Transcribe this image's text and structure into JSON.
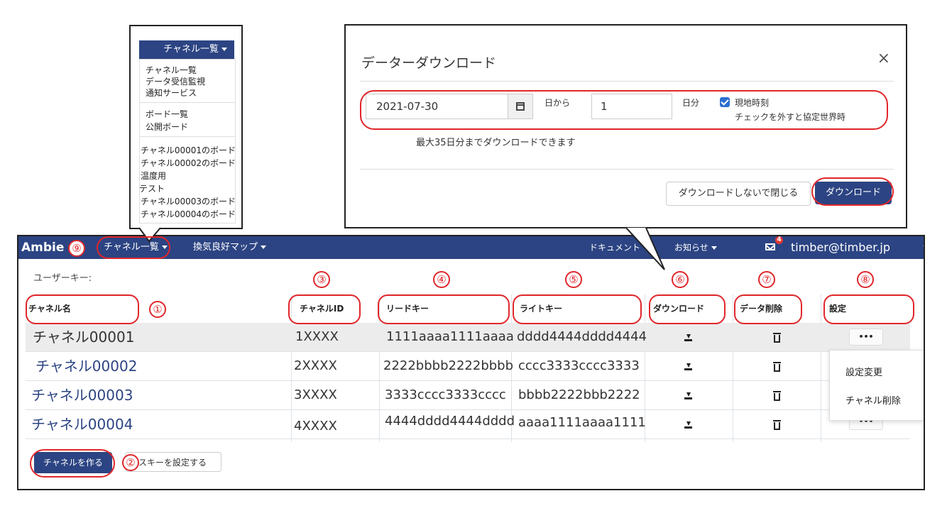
{
  "navbar": {
    "brand": "Ambie",
    "channel_menu": "チャネル一覧",
    "ventilation_map": "換気良好マップ",
    "documents": "ドキュメント",
    "notices": "お知らせ",
    "mail_badge": "4",
    "user": "timber@timber.jp"
  },
  "user_key_label": "ユーザーキー:",
  "table": {
    "headers": {
      "name": "チャネル名",
      "id": "チャネルID",
      "read_key": "リードキー",
      "write_key": "ライトキー",
      "download": "ダウンロード",
      "delete": "データ削除",
      "settings": "設定"
    },
    "rows": [
      {
        "name": "チャネル00001",
        "id": "1XXXX",
        "read_key": "1111aaaa1111aaaa",
        "write_key": "dddd4444dddd4444"
      },
      {
        "name": "チャネル00002",
        "id": "2XXXX",
        "read_key": "2222bbbb2222bbbb",
        "write_key": "cccc3333cccc3333"
      },
      {
        "name": "チャネル00003",
        "id": "3XXXX",
        "read_key": "3333cccc3333cccc",
        "write_key": "bbbb2222bbb2222"
      },
      {
        "name": "チャネル00004",
        "id": "4XXXX",
        "read_key": "4444dddd4444dddd",
        "write_key": "aaaa1111aaaa1111"
      }
    ],
    "settings_button": "•••"
  },
  "settings_menu": {
    "change": "設定変更",
    "delete": "チャネル削除"
  },
  "buttons": {
    "create_channel": "チャネルを作る",
    "set_key": "スキーを設定する"
  },
  "annotations": [
    "①",
    "②",
    "③",
    "④",
    "⑤",
    "⑥",
    "⑦",
    "⑧",
    "⑨"
  ],
  "channel_dropdown": {
    "title": "チャネル一覧",
    "group1": [
      "チャネル一覧",
      "データ受信監視",
      "通知サービス"
    ],
    "group2": [
      "ボード一覧",
      "公開ボード"
    ],
    "group3": [
      "チャネル00001のボード",
      "チャネル00002のボード",
      "温度用",
      "テスト",
      "チャネル00003のボード",
      "チャネル00004のボード"
    ]
  },
  "download_modal": {
    "title": "データーダウンロード",
    "close": "×",
    "date": "2021-07-30",
    "from_label": "日から",
    "days": "1",
    "days_label": "日分",
    "local_time_label": "現地時刻",
    "utc_note": "チェックを外すと協定世界時",
    "max_note": "最大35日分までダウンロードできます",
    "close_button": "ダウンロードしないで閉じる",
    "download_button": "ダウンロード"
  },
  "colors": {
    "navbar": "#2c4483",
    "annotation": "#e0262a",
    "link": "#2c4483"
  }
}
